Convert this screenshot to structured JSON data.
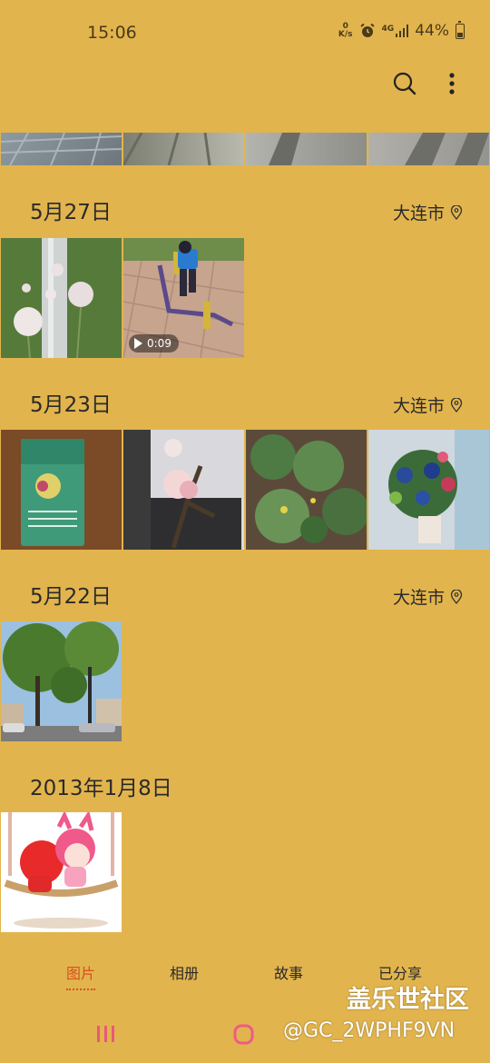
{
  "status_bar": {
    "time": "15:06",
    "net_speed_value": "0",
    "net_speed_unit": "K/s",
    "network_type": "4G",
    "battery": "44%",
    "battery_level": 0.44
  },
  "toolbar": {
    "search_icon": "search-icon",
    "more_icon": "more-vertical-icon"
  },
  "sections": [
    {
      "date": "5月27日",
      "location": "大连市"
    },
    {
      "date": "5月23日",
      "location": "大连市"
    },
    {
      "date": "5月22日",
      "location": "大连市"
    },
    {
      "date": "2013年1月8日"
    }
  ],
  "video": {
    "duration": "0:09"
  },
  "bottom_nav": {
    "items": [
      {
        "label": "图片",
        "active": true
      },
      {
        "label": "相册",
        "active": false
      },
      {
        "label": "故事",
        "active": false
      },
      {
        "label": "已分享",
        "active": false
      }
    ]
  },
  "overlay": {
    "brand_watermark": "盖乐世社区",
    "handle_watermark": "@GC_2WPHF9VN"
  },
  "colors": {
    "background": "#e2b44d",
    "active_tab": "#d9501e"
  }
}
